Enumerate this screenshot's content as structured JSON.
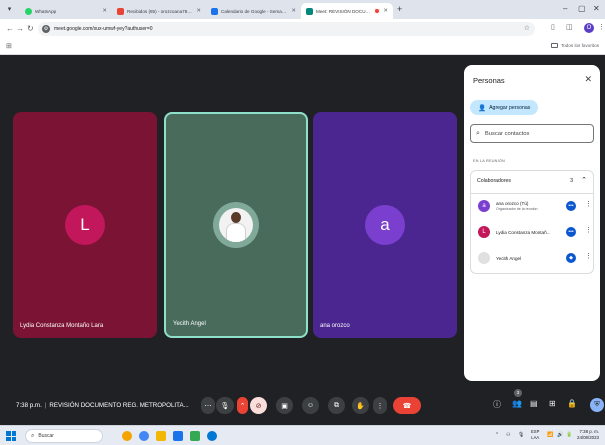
{
  "browser": {
    "tabs": [
      {
        "label": "WhatsApp",
        "active": false,
        "color": "#25d366"
      },
      {
        "label": "Recibidos (85) - orozcoana784@...",
        "active": false,
        "color": "#ea4335"
      },
      {
        "label": "Calendario de Google - Semana...",
        "active": false,
        "color": "#1a73e8"
      },
      {
        "label": "Meet: REVISIÓN DOCUMENTO...",
        "active": true,
        "color": "#00897b"
      }
    ],
    "url": "meet.google.com/xux-umwf-yey?authuser=0",
    "bookmarks_all_label": "Todos los favoritos",
    "profile_initial": "O"
  },
  "meet": {
    "tiles": [
      {
        "initial": "L",
        "name": "Lydia Constanza Montaño Lara"
      },
      {
        "initial": "",
        "name": "Yecith Angel"
      },
      {
        "initial": "a",
        "name": "ana orozco"
      }
    ],
    "meeting_time": "7:38 p.m.",
    "meeting_title": "REVISIÓN DOCUMENTO REG. METROPOLITA...",
    "participant_count": "3"
  },
  "people_panel": {
    "title": "Personas",
    "add_people_label": "Agregar personas",
    "search_placeholder": "Buscar contactos",
    "section_label": "EN LA REUNIÓN",
    "group": {
      "label": "Colaboradores",
      "count": "3",
      "members": [
        {
          "initial": "a",
          "name": "ana orozco (Tú)",
          "subtitle": "Organizador de la reunión",
          "color": "#7b3fcf"
        },
        {
          "initial": "L",
          "name": "Lydia Constanza Montañ...",
          "subtitle": "",
          "color": "#c2185b"
        },
        {
          "initial": "",
          "name": "Yecith Angel",
          "subtitle": "",
          "color": "#e0e0e0"
        }
      ]
    }
  },
  "taskbar": {
    "search_label": "Buscar",
    "language": "ESP",
    "language_sub": "LAA",
    "time": "7:38 p. m.",
    "date": "24/08/2023"
  },
  "colors": {
    "stage_bg": "#202124",
    "end_call": "#ea4335",
    "accent_blue": "#0b57d0"
  }
}
